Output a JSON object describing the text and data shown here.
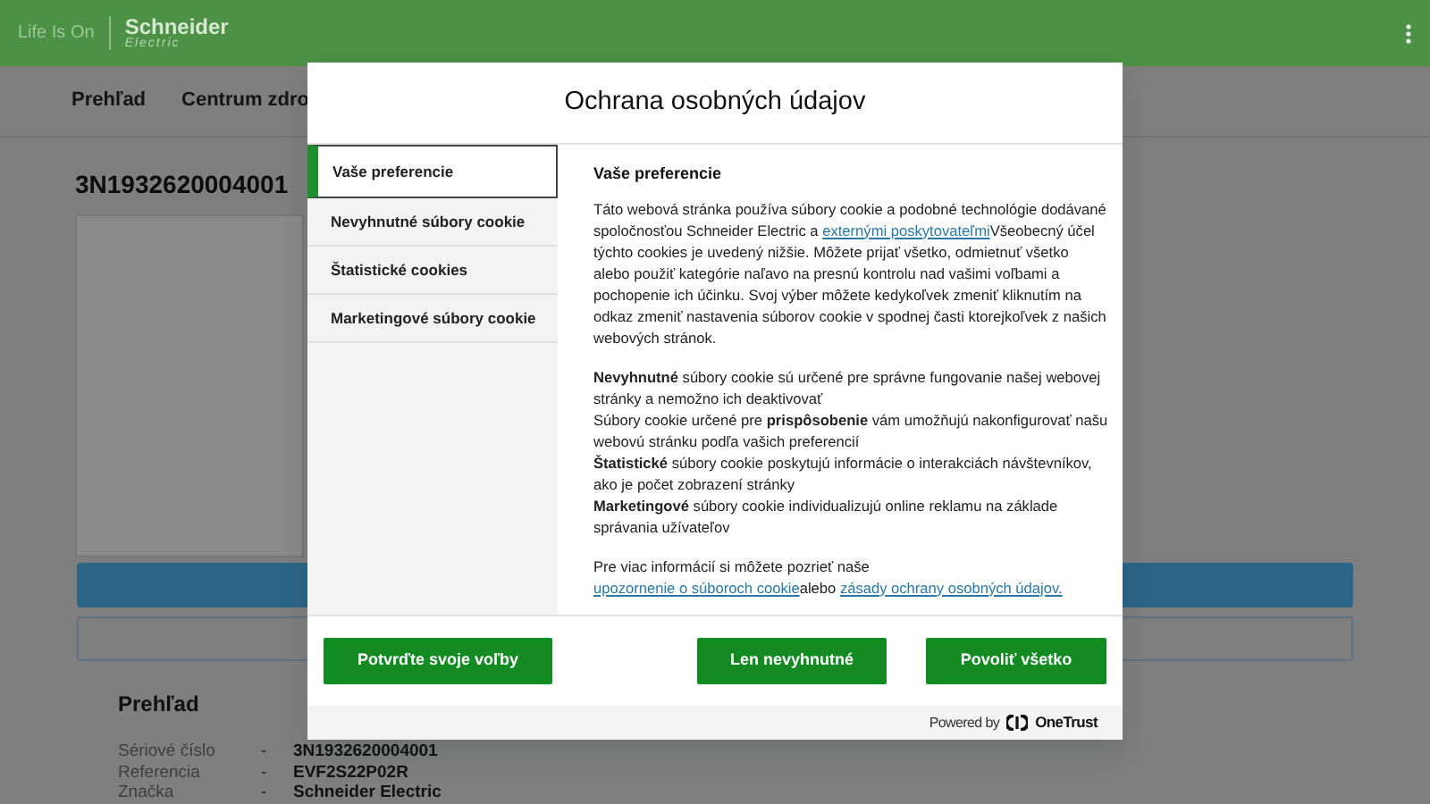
{
  "header": {
    "tagline": "Life Is On",
    "brand": "Schneider",
    "brand_sub": "Electric"
  },
  "nav": [
    {
      "label": "Prehľad"
    },
    {
      "label": "Centrum zdro"
    }
  ],
  "page_title": "3N1932620004001",
  "overview": {
    "title": "Prehľad",
    "rows": [
      {
        "label": "Sériové číslo",
        "separator": "-",
        "value": "3N1932620004001"
      },
      {
        "label": "Referencia",
        "separator": "-",
        "value": "EVF2S22P02R"
      },
      {
        "label": "Značka",
        "separator": "-",
        "value": "Schneider Electric"
      }
    ]
  },
  "modal": {
    "title": "Ochrana osobných údajov",
    "tabs": [
      {
        "label": "Vaše preferencie",
        "selected": true
      },
      {
        "label": "Nevyhnutné súbory cookie",
        "selected": false
      },
      {
        "label": "Štatistické cookies",
        "selected": false
      },
      {
        "label": "Marketingové súbory cookie",
        "selected": false
      }
    ],
    "heading": "Vaše preferencie",
    "paragraphs": [
      [
        {
          "kind": "text",
          "text": "Táto webová stránka používa súbory cookie a podobné technológie dodávané spoločnosťou Schneider Electric a "
        },
        {
          "kind": "link",
          "text": "externými poskytovateľmi"
        },
        {
          "kind": "text",
          "text": "Všeobecný účel týchto cookies je uvedený nižšie. Môžete prijať všetko, odmietnuť všetko alebo použiť kategórie naľavo na presnú kontrolu nad vašimi voľbami a pochopenie ich účinku. Svoj výber môžete kedykoľvek zmeniť kliknutím na odkaz zmeniť nastavenia súborov cookie v spodnej časti ktorejkoľvek z našich webových stránok."
        }
      ],
      [
        {
          "kind": "text",
          "text": "**Nevyhnutné** súbory cookie sú určené pre správne fungovanie našej webovej stránky a nemožno ich deaktivovať"
        }
      ],
      [
        {
          "kind": "text",
          "text": "Súbory cookie určené pre **prispôsobenie** vám umožňujú nakonfigurovať našu webovú stránku podľa vašich preferencií"
        }
      ],
      [
        {
          "kind": "text",
          "text": "**Štatistické** súbory cookie poskytujú informácie o interakciách návštevníkov, ako je počet zobrazení stránky"
        }
      ],
      [
        {
          "kind": "text",
          "text": "**Marketingové** súbory cookie individualizujú online reklamu na základe správania užívateľov"
        }
      ],
      [
        {
          "kind": "text",
          "text": "Pre viac informácií si môžete pozrieť naše "
        },
        {
          "kind": "link",
          "text": "upozornenie o súboroch cookie"
        },
        {
          "kind": "text",
          "text": "alebo "
        },
        {
          "kind": "link",
          "text": "zásady ochrany osobných údajov."
        }
      ]
    ],
    "buttons": [
      {
        "label": "Potvrďte svoje voľby"
      },
      {
        "label": "Len nevyhnutné"
      },
      {
        "label": "Povoliť všetko"
      }
    ],
    "powered_by": {
      "text": "Powered by",
      "brand": "OneTrust"
    }
  }
}
